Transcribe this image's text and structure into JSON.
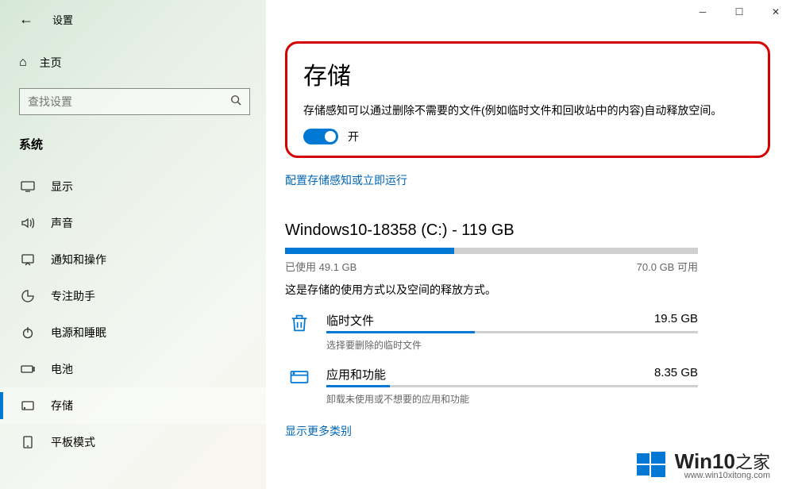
{
  "app_title": "设置",
  "home_label": "主页",
  "search": {
    "placeholder": "查找设置"
  },
  "section_label": "系统",
  "nav": [
    {
      "label": "显示",
      "icon": "display"
    },
    {
      "label": "声音",
      "icon": "sound"
    },
    {
      "label": "通知和操作",
      "icon": "notify"
    },
    {
      "label": "专注助手",
      "icon": "focus"
    },
    {
      "label": "电源和睡眠",
      "icon": "power"
    },
    {
      "label": "电池",
      "icon": "battery"
    },
    {
      "label": "存储",
      "icon": "storage",
      "active": true
    },
    {
      "label": "平板模式",
      "icon": "tablet"
    }
  ],
  "page": {
    "title": "存储",
    "description": "存储感知可以通过删除不需要的文件(例如临时文件和回收站中的内容)自动释放空间。",
    "toggle_label": "开",
    "config_link": "配置存储感知或立即运行"
  },
  "drive": {
    "title": "Windows10-18358 (C:) - 119 GB",
    "used_label": "已使用",
    "used_value": "49.1 GB",
    "free_value": "70.0 GB",
    "free_label": "可用",
    "description": "这是存储的使用方式以及空间的释放方式。"
  },
  "categories": [
    {
      "name": "临时文件",
      "size": "19.5 GB",
      "sub": "选择要删除的临时文件",
      "fill": 40
    },
    {
      "name": "应用和功能",
      "size": "8.35 GB",
      "sub": "卸载未使用或不想要的应用和功能",
      "fill": 17
    }
  ],
  "show_more": "显示更多类别",
  "watermark": {
    "brand": "Win10",
    "suffix": "之家",
    "url": "www.win10xitong.com"
  },
  "colors": {
    "accent": "#0078d4",
    "highlight_border": "#d60000"
  }
}
